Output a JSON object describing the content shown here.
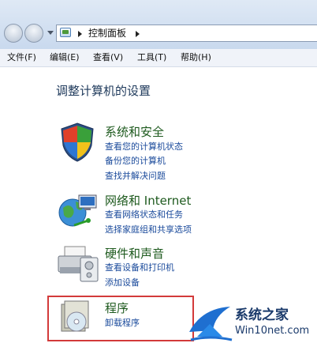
{
  "address": {
    "text": "控制面板"
  },
  "menu": [
    "文件(F)",
    "编辑(E)",
    "查看(V)",
    "工具(T)",
    "帮助(H)"
  ],
  "page_title": "调整计算机的设置",
  "categories": [
    {
      "title": "系统和安全",
      "icon": "shield-icon",
      "links": [
        "查看您的计算机状态",
        "备份您的计算机",
        "查找并解决问题"
      ]
    },
    {
      "title": "网络和 Internet",
      "icon": "network-globe-icon",
      "links": [
        "查看网络状态和任务",
        "选择家庭组和共享选项"
      ]
    },
    {
      "title": "硬件和声音",
      "icon": "printer-icon",
      "links": [
        "查看设备和打印机",
        "添加设备"
      ]
    },
    {
      "title": "程序",
      "icon": "programs-box-icon",
      "links": [
        "卸载程序"
      ]
    }
  ],
  "highlight_color": "#d33a3a",
  "watermark": {
    "title": "系统之家",
    "sub": "Win10net.com"
  }
}
